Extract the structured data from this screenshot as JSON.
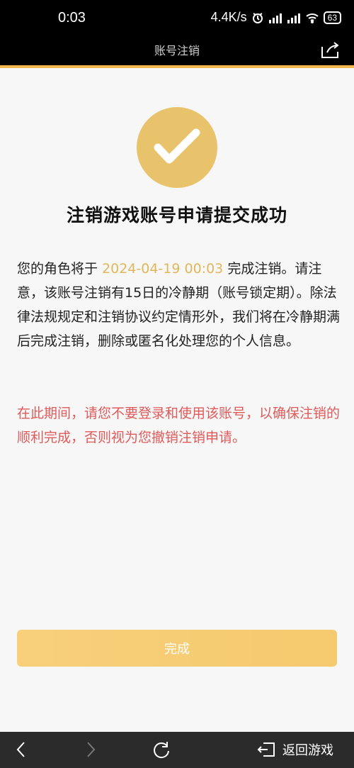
{
  "status_bar": {
    "time": "0:03",
    "speed": "4.4K/s",
    "battery": "63"
  },
  "header": {
    "title": "账号注销"
  },
  "main": {
    "headline": "注销游戏账号申请提交成功",
    "paragraph_before": "您的角色将于 ",
    "date": "2024-04-19 00:03",
    "paragraph_after": " 完成注销。请注意，该账号注销有15日的冷静期（账号锁定期）。除法律法规规定和注销协议约定情形外，我们将在冷静期满后完成注销，删除或匿名化处理您的个人信息。",
    "warning": "在此期间，请您不要登录和使用该账号，以确保注销的顺利完成，否则视为您撤销注销申请。",
    "done_label": "完成"
  },
  "bottom_nav": {
    "return_label": "返回游戏"
  },
  "icons": {
    "status": [
      "alarm-icon",
      "signal-hd-icon",
      "signal-hd-icon",
      "wifi-icon",
      "battery-icon"
    ],
    "header": "share-icon",
    "main": "checkmark-icon",
    "bottom": [
      "back-arrow-icon",
      "forward-arrow-icon",
      "refresh-icon",
      "exit-icon"
    ]
  },
  "colors": {
    "accent": "#e9c36b",
    "date": "#e2b65a",
    "warning": "#e05a5a",
    "header_line": "#f2b74a",
    "button": "#f7cc74"
  }
}
